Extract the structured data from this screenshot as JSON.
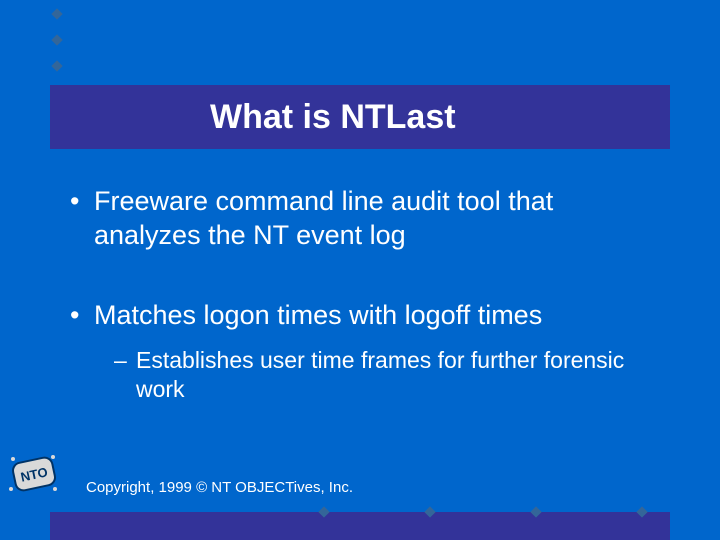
{
  "title": "What is NTLast",
  "bullets": {
    "item1": "Freeware command line audit tool that analyzes the NT event log",
    "item2": "Matches logon times with logoff times",
    "sub2a": "Establishes user time frames for further forensic work"
  },
  "logo_text": "NTO",
  "copyright": "Copyright, 1999 © NT OBJECTives, Inc.",
  "colors": {
    "background": "#0066cc",
    "accent": "#333399",
    "text": "#ffffff"
  }
}
